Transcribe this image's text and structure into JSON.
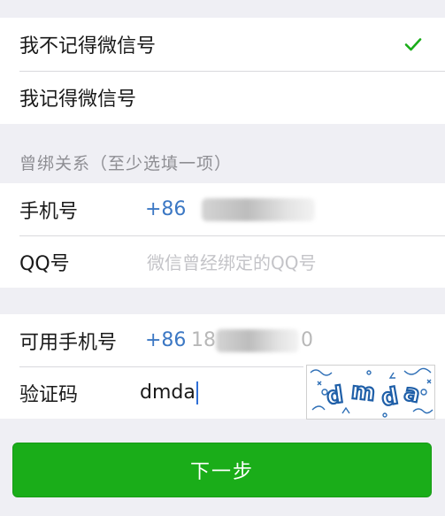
{
  "recovery_options": {
    "forgot_wechat_id": "我不记得微信号",
    "remember_wechat_id": "我记得微信号",
    "selected": "forgot_wechat_id"
  },
  "binding": {
    "header": "曾绑关系（至少选填一项）",
    "phone_label": "手机号",
    "phone_prefix": "+86",
    "qq_label": "QQ号",
    "qq_placeholder": "微信曾经绑定的QQ号"
  },
  "verify": {
    "available_phone_label": "可用手机号",
    "available_phone_prefix": "+86",
    "available_phone_partial_start": "18",
    "available_phone_partial_end": "0",
    "code_label": "验证码",
    "code_value": "dmda",
    "captcha_text": "dmda"
  },
  "next_button_label": "下一步",
  "colors": {
    "background": "#efeff4",
    "accent_green": "#1aad19",
    "link_blue": "#3c78c4"
  }
}
